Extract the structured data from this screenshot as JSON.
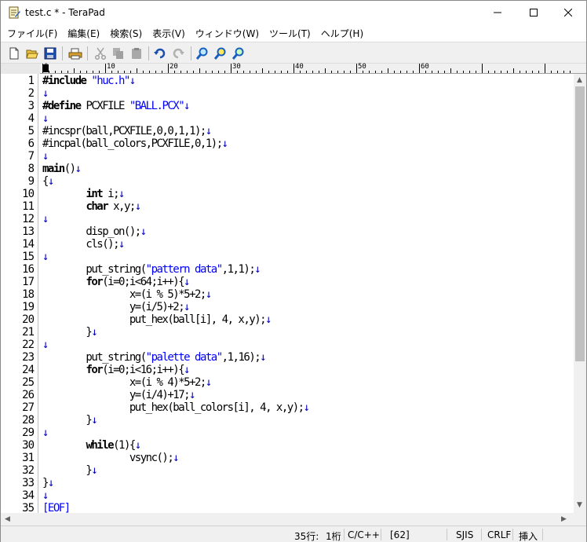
{
  "window": {
    "title": "test.c * - TeraPad"
  },
  "menu": [
    "ファイル(F)",
    "編集(E)",
    "検索(S)",
    "表示(V)",
    "ウィンドウ(W)",
    "ツール(T)",
    "ヘルプ(H)"
  ],
  "toolbar": {
    "icons": [
      "new-file-icon",
      "open-folder-icon",
      "save-icon",
      "print-icon",
      "cut-icon",
      "copy-icon",
      "paste-icon",
      "undo-icon",
      "redo-icon",
      "search-icon",
      "search-next-icon",
      "search-prev-icon"
    ]
  },
  "ruler": {
    "marks": [
      "0",
      "10",
      "20",
      "30",
      "40",
      "50",
      "60"
    ]
  },
  "editor": {
    "newline_mark": "↓",
    "lines": [
      {
        "n": "1",
        "segs": [
          {
            "t": "#include ",
            "c": "kw"
          },
          {
            "t": "\"huc.h\"",
            "c": "str"
          }
        ],
        "nl": true
      },
      {
        "n": "2",
        "segs": [],
        "nl": true
      },
      {
        "n": "3",
        "segs": [
          {
            "t": "#define ",
            "c": "kw"
          },
          {
            "t": "PCXFILE ",
            "c": ""
          },
          {
            "t": "\"BALL.PCX\"",
            "c": "str"
          }
        ],
        "nl": true
      },
      {
        "n": "4",
        "segs": [],
        "nl": true
      },
      {
        "n": "5",
        "segs": [
          {
            "t": "#incspr(ball,PCXFILE,0,0,1,1);",
            "c": ""
          }
        ],
        "nl": true
      },
      {
        "n": "6",
        "segs": [
          {
            "t": "#incpal(ball_colors,PCXFILE,0,1);",
            "c": ""
          }
        ],
        "nl": true
      },
      {
        "n": "7",
        "segs": [],
        "nl": true
      },
      {
        "n": "8",
        "segs": [
          {
            "t": "main",
            "c": "kw"
          },
          {
            "t": "()",
            "c": ""
          }
        ],
        "nl": true
      },
      {
        "n": "9",
        "segs": [
          {
            "t": "{",
            "c": ""
          }
        ],
        "nl": true
      },
      {
        "n": "10",
        "segs": [
          {
            "t": "        ",
            "c": ""
          },
          {
            "t": "int",
            "c": "kw"
          },
          {
            "t": " i;",
            "c": ""
          }
        ],
        "nl": true
      },
      {
        "n": "11",
        "segs": [
          {
            "t": "        ",
            "c": ""
          },
          {
            "t": "char",
            "c": "kw"
          },
          {
            "t": " x,y;",
            "c": ""
          }
        ],
        "nl": true
      },
      {
        "n": "12",
        "segs": [],
        "nl": true
      },
      {
        "n": "13",
        "segs": [
          {
            "t": "        disp_on();",
            "c": ""
          }
        ],
        "nl": true
      },
      {
        "n": "14",
        "segs": [
          {
            "t": "        cls();",
            "c": ""
          }
        ],
        "nl": true
      },
      {
        "n": "15",
        "segs": [],
        "nl": true
      },
      {
        "n": "16",
        "segs": [
          {
            "t": "        put_string(",
            "c": ""
          },
          {
            "t": "\"pattern data\"",
            "c": "str"
          },
          {
            "t": ",1,1);",
            "c": ""
          }
        ],
        "nl": true
      },
      {
        "n": "17",
        "segs": [
          {
            "t": "        ",
            "c": ""
          },
          {
            "t": "for",
            "c": "kw"
          },
          {
            "t": "(i=0;i<64;i++){",
            "c": ""
          }
        ],
        "nl": true
      },
      {
        "n": "18",
        "segs": [
          {
            "t": "                x=(i % 5)*5+2;",
            "c": ""
          }
        ],
        "nl": true
      },
      {
        "n": "19",
        "segs": [
          {
            "t": "                y=(i/5)+2;",
            "c": ""
          }
        ],
        "nl": true
      },
      {
        "n": "20",
        "segs": [
          {
            "t": "                put_hex(ball[i], 4, x,y);",
            "c": ""
          }
        ],
        "nl": true
      },
      {
        "n": "21",
        "segs": [
          {
            "t": "        }",
            "c": ""
          }
        ],
        "nl": true
      },
      {
        "n": "22",
        "segs": [],
        "nl": true
      },
      {
        "n": "23",
        "segs": [
          {
            "t": "        put_string(",
            "c": ""
          },
          {
            "t": "\"palette data\"",
            "c": "str"
          },
          {
            "t": ",1,16);",
            "c": ""
          }
        ],
        "nl": true
      },
      {
        "n": "24",
        "segs": [
          {
            "t": "        ",
            "c": ""
          },
          {
            "t": "for",
            "c": "kw"
          },
          {
            "t": "(i=0;i<16;i++){",
            "c": ""
          }
        ],
        "nl": true
      },
      {
        "n": "25",
        "segs": [
          {
            "t": "                x=(i % 4)*5+2;",
            "c": ""
          }
        ],
        "nl": true
      },
      {
        "n": "26",
        "segs": [
          {
            "t": "                y=(i/4)+17;",
            "c": ""
          }
        ],
        "nl": true
      },
      {
        "n": "27",
        "segs": [
          {
            "t": "                put_hex(ball_colors[i], 4, x,y);",
            "c": ""
          }
        ],
        "nl": true
      },
      {
        "n": "28",
        "segs": [
          {
            "t": "        }",
            "c": ""
          }
        ],
        "nl": true
      },
      {
        "n": "29",
        "segs": [],
        "nl": true
      },
      {
        "n": "30",
        "segs": [
          {
            "t": "        ",
            "c": ""
          },
          {
            "t": "while",
            "c": "kw"
          },
          {
            "t": "(1){",
            "c": ""
          }
        ],
        "nl": true
      },
      {
        "n": "31",
        "segs": [
          {
            "t": "                vsync();",
            "c": ""
          }
        ],
        "nl": true
      },
      {
        "n": "32",
        "segs": [
          {
            "t": "        }",
            "c": ""
          }
        ],
        "nl": true
      },
      {
        "n": "33",
        "segs": [
          {
            "t": "}",
            "c": ""
          }
        ],
        "nl": true
      },
      {
        "n": "34",
        "segs": [],
        "nl": true
      },
      {
        "n": "35",
        "segs": [
          {
            "t": "[EOF]",
            "c": "eof"
          }
        ],
        "nl": false
      }
    ]
  },
  "status": {
    "line": "35行:",
    "col": "1桁",
    "mode": "C/C++",
    "code": "[62]",
    "encoding": "SJIS",
    "eol": "CRLF",
    "insert": "挿入"
  },
  "colors": {
    "keyword": "#000000",
    "string": "#0000ff",
    "newline": "#0000c0"
  }
}
